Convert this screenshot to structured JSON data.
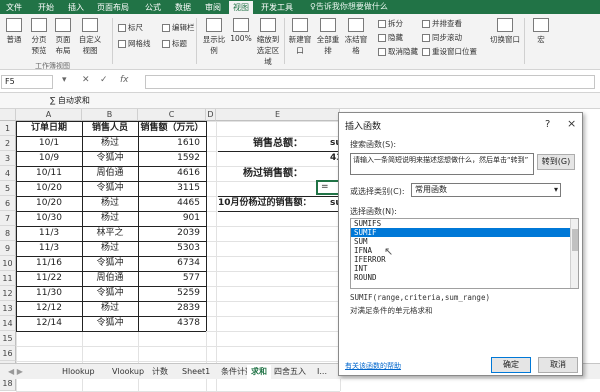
{
  "tabs": [
    {
      "label": "文件"
    },
    {
      "label": "开始"
    },
    {
      "label": "插入"
    },
    {
      "label": "页面布局"
    },
    {
      "label": "公式"
    },
    {
      "label": "数据"
    },
    {
      "label": "审阅"
    },
    {
      "label": "视图"
    },
    {
      "label": "开发工具"
    },
    {
      "label": "♀告诉我你想要做什么"
    }
  ],
  "ribbon": {
    "view_normal": "普通",
    "view_pagebreak": "分页预览",
    "view_layout": "页面布局",
    "view_custom": "自定义视图",
    "ruler": "标尺",
    "formula_bar": "编辑栏",
    "gridlines": "网格线",
    "headings": "标题",
    "zoom": "显示比例",
    "zoom_100": "100%",
    "zoom_sel": "缩放到选定区域",
    "new_window": "新建窗口",
    "arrange_all": "全部重排",
    "freeze": "冻结窗格",
    "split": "拆分",
    "hide": "隐藏",
    "unhide": "取消隐藏",
    "view_side": "并排查看",
    "sync_scroll": "同步滚动",
    "reset_pos": "重设窗口位置",
    "switch_win": "切换窗口",
    "macro": "宏",
    "group_workbook_views": "工作簿视图"
  },
  "namebox": "F5",
  "toolbar2": {
    "label": "∑ 自动求和"
  },
  "columns": [
    "A",
    "B",
    "C",
    "D",
    "E",
    "F"
  ],
  "header_row": {
    "date": "订单日期",
    "person": "销售人员",
    "amount": "销售额（万元）"
  },
  "rows": [
    {
      "date": "10/1",
      "person": "杨过",
      "amount": "1610"
    },
    {
      "date": "10/9",
      "person": "令狐冲",
      "amount": "1592"
    },
    {
      "date": "10/11",
      "person": "周伯通",
      "amount": "4616"
    },
    {
      "date": "10/20",
      "person": "令狐冲",
      "amount": "3115"
    },
    {
      "date": "10/20",
      "person": "杨过",
      "amount": "4465"
    },
    {
      "date": "10/30",
      "person": "杨过",
      "amount": "901"
    },
    {
      "date": "11/3",
      "person": "林平之",
      "amount": "2039"
    },
    {
      "date": "11/3",
      "person": "杨过",
      "amount": "5303"
    },
    {
      "date": "11/16",
      "person": "令狐冲",
      "amount": "6734"
    },
    {
      "date": "11/22",
      "person": "周伯通",
      "amount": "577"
    },
    {
      "date": "11/30",
      "person": "令狐冲",
      "amount": "5259"
    },
    {
      "date": "12/12",
      "person": "杨过",
      "amount": "2839"
    },
    {
      "date": "12/14",
      "person": "令狐冲",
      "amount": "4378"
    }
  ],
  "row_numbers": [
    "1",
    "2",
    "3",
    "4",
    "5",
    "6",
    "7",
    "8",
    "9",
    "10",
    "11",
    "12",
    "13",
    "14",
    "15",
    "16",
    "17",
    "18"
  ],
  "summary": {
    "total_label": "销售总额：",
    "total_value": "su",
    "yangguo_label": "杨过销售额：",
    "yangguo_value": "43",
    "formula_cell": "=",
    "oct_label": "10月份杨过的销售额：",
    "oct_value": "su"
  },
  "dialog": {
    "title": "插入函数",
    "help": "?",
    "close": "×",
    "search_label": "搜索函数(S):",
    "search_value": "请输入一条简短说明来描述您想做什么，然后单击“转到”",
    "go_button": "转到(G)",
    "category_label": "或选择类别(C):",
    "category_value": "常用函数",
    "list_label": "选择函数(N):",
    "functions": [
      "SUMIFS",
      "SUMIF",
      "SUM",
      "IFNA",
      "IFERROR",
      "INT",
      "ROUND"
    ],
    "selected": "SUMIF",
    "signature": "SUMIF(range,criteria,sum_range)",
    "description": "对满足条件的单元格求和",
    "help_link": "有关该函数的帮助",
    "ok": "确定",
    "cancel": "取消"
  },
  "sheet_tabs": [
    {
      "label": "Hlookup"
    },
    {
      "label": "Vlookup"
    },
    {
      "label": "计数"
    },
    {
      "label": "Sheet1"
    },
    {
      "label": "条件计数"
    },
    {
      "label": "求和"
    },
    {
      "label": "四舍五入"
    },
    {
      "label": "I..."
    }
  ],
  "sheet_nav": "◀ ▶",
  "colors": {
    "accent": "#217346",
    "selection": "#0078d7"
  }
}
